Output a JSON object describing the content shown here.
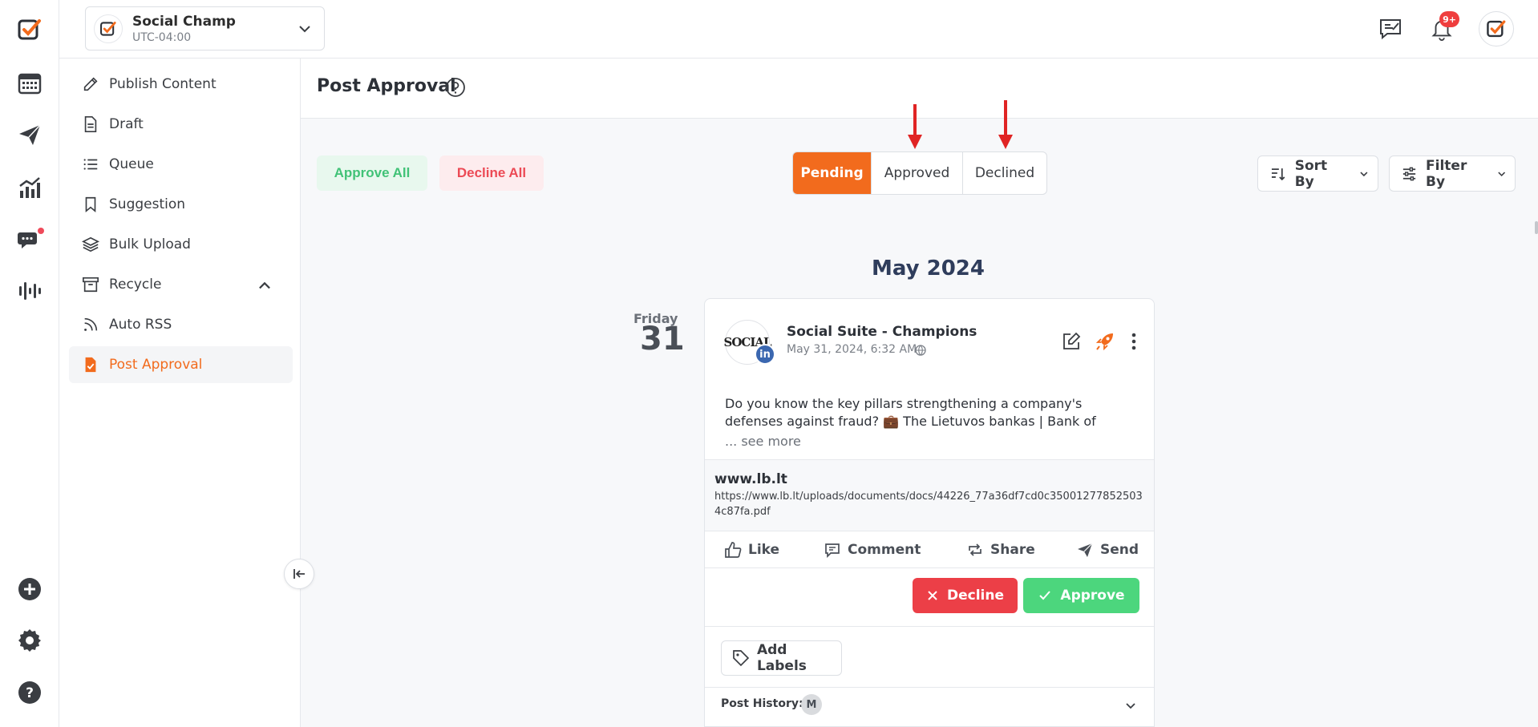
{
  "workspace": {
    "name": "Social Champ",
    "timezone": "UTC-04:00"
  },
  "topbar": {
    "notifications_badge": "9+"
  },
  "sidebar": {
    "items": [
      {
        "label": "Publish Content",
        "icon": "pencil-icon"
      },
      {
        "label": "Draft",
        "icon": "document-icon"
      },
      {
        "label": "Queue",
        "icon": "list-icon"
      },
      {
        "label": "Suggestion",
        "icon": "bookmark-icon"
      },
      {
        "label": "Bulk Upload",
        "icon": "layers-icon"
      },
      {
        "label": "Recycle",
        "icon": "archive-icon"
      },
      {
        "label": "Auto RSS",
        "icon": "rss-icon"
      },
      {
        "label": "Post Approval",
        "icon": "post-approval-icon"
      }
    ]
  },
  "page": {
    "title": "Post Approval"
  },
  "toolbar": {
    "approve_all": "Approve All",
    "decline_all": "Decline All",
    "tabs": [
      "Pending",
      "Approved",
      "Declined"
    ],
    "sort_label": "Sort By",
    "filter_label": "Filter By"
  },
  "timeline": {
    "month": "May 2024",
    "day_name": "Friday",
    "day_number": "31"
  },
  "post": {
    "account": "Social Suite - Champions",
    "avatar_text": "SOCIAL",
    "network_badge": "in",
    "date": "May 31, 2024, 6:32 AM",
    "text": "Do you know the key pillars strengthening a company's defenses against fraud? 💼 The Lietuvos bankas | Bank of",
    "see_more": "... see more",
    "link_domain": "www.lb.lt",
    "link_url": "https://www.lb.lt/uploads/documents/docs/44226_77a36df7cd0c350012778525034c87fa.pdf",
    "actions": {
      "like": "Like",
      "comment": "Comment",
      "share": "Share",
      "send": "Send"
    },
    "decline_label": "Decline",
    "approve_label": "Approve",
    "add_labels": "Add Labels",
    "history_label": "Post History:",
    "history_avatar": "M"
  },
  "colors": {
    "accent": "#f26b1d",
    "approve": "#4cd67d",
    "decline": "#ec3f47",
    "linkedin": "#3b67b0"
  }
}
